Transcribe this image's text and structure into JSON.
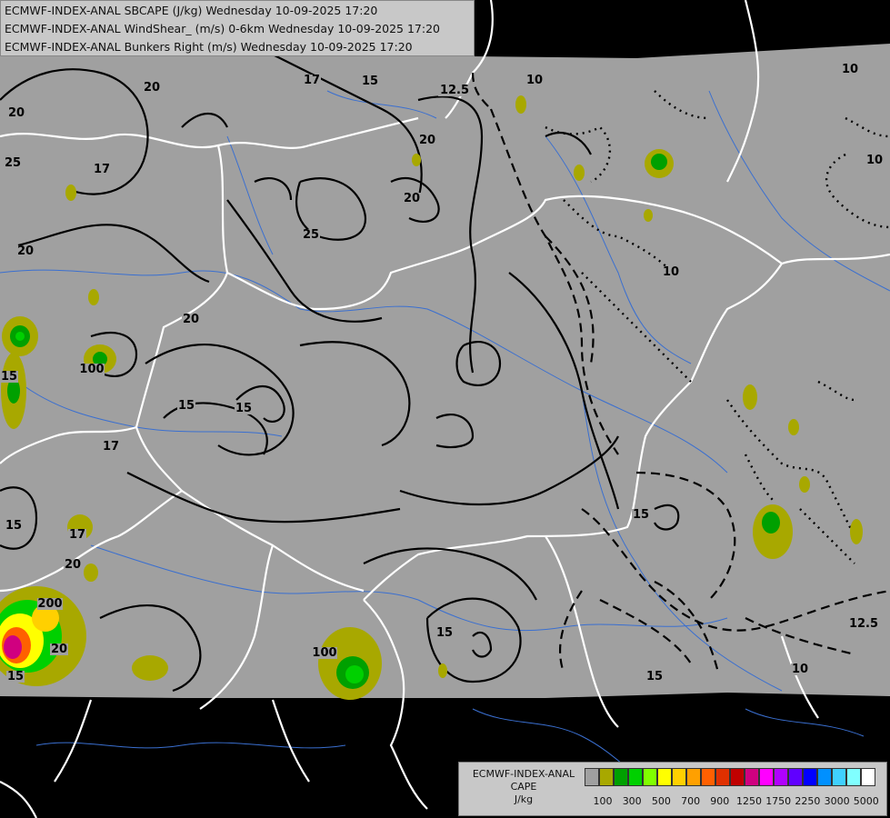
{
  "titles": [
    "ECMWF-INDEX-ANAL SBCAPE (J/kg) Wednesday 10-09-2025 17:20",
    "ECMWF-INDEX-ANAL WindShear_ (m/s) 0-6km Wednesday 10-09-2025 17:20",
    "ECMWF-INDEX-ANAL Bunkers Right (m/s) Wednesday 10-09-2025 17:20"
  ],
  "legend": {
    "title_line1": "ECMWF-INDEX-ANAL",
    "title_line2": "CAPE",
    "title_line3": "J/kg",
    "colors": [
      "#a0a0a0",
      "#a8a800",
      "#00a000",
      "#00d000",
      "#80ff00",
      "#ffff00",
      "#ffd000",
      "#ffa000",
      "#ff6000",
      "#e03000",
      "#c00000",
      "#d00080",
      "#ff00ff",
      "#b000ff",
      "#6000ff",
      "#0000ff",
      "#0090ff",
      "#40d0ff",
      "#80ffff",
      "#ffffff"
    ],
    "tick_labels": [
      "100",
      "300",
      "500",
      "700",
      "900",
      "1250",
      "1750",
      "2250",
      "3000",
      "5000"
    ]
  },
  "contour_labels": [
    "17",
    "15",
    "12.5",
    "10",
    "20",
    "20",
    "25",
    "20",
    "17",
    "20",
    "25",
    "20",
    "10",
    "10",
    "20",
    "15",
    "15",
    "17",
    "15",
    "20",
    "15",
    "15",
    "100",
    "200",
    "15",
    "100",
    "15",
    "12.5",
    "10",
    "15",
    "17",
    "10",
    "20"
  ],
  "colors": {
    "domain_gray": "#a0a0a0",
    "outside_black": "#000000",
    "borders_white": "#ffffff",
    "rivers_blue": "#3a6fd0",
    "contour_black": "#000000"
  }
}
